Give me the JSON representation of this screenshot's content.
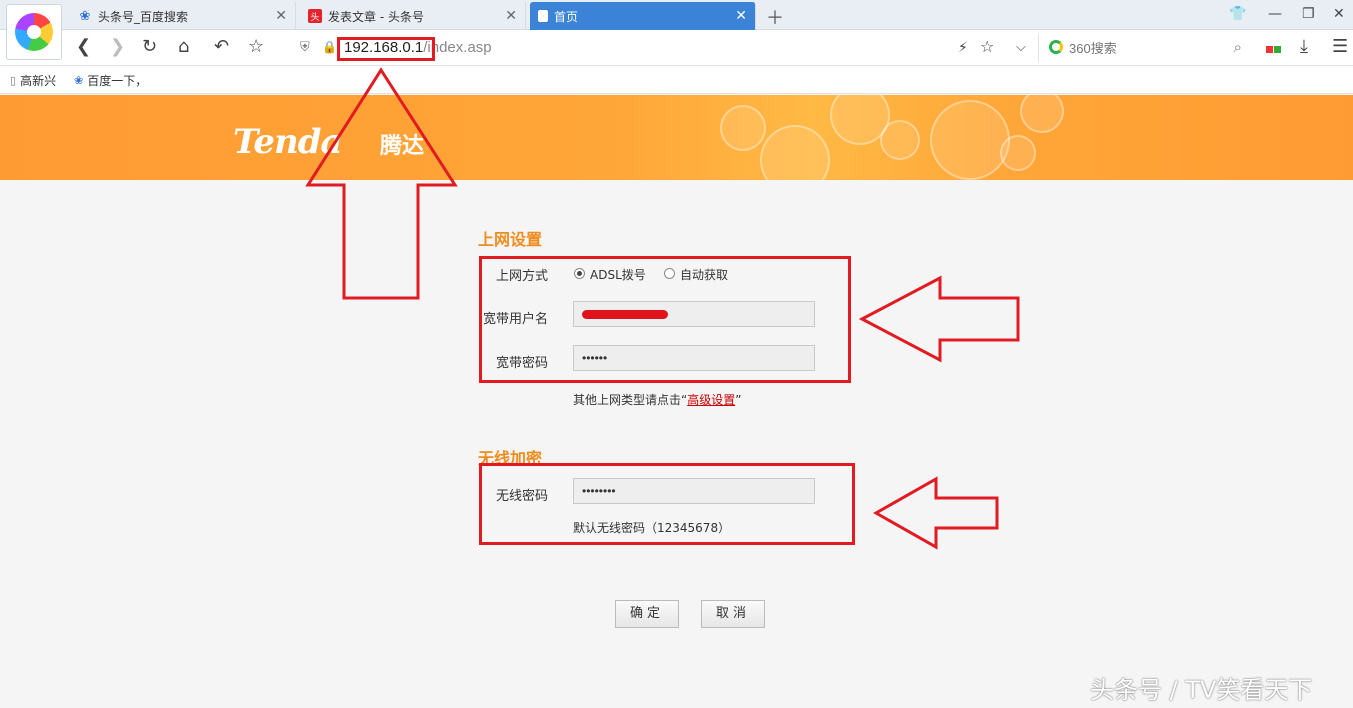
{
  "tabs": [
    {
      "title": "头条号_百度搜索",
      "active": false
    },
    {
      "title": "发表文章 - 头条号",
      "active": false
    },
    {
      "title": "首页",
      "active": true
    }
  ],
  "address": {
    "host": "192.168.0.1",
    "path": "/index.asp"
  },
  "search": {
    "placeholder": "360搜索"
  },
  "bookmarks": [
    "高新兴",
    "百度一下，"
  ],
  "brand": {
    "name": "Tenda",
    "cn": "腾达"
  },
  "internet": {
    "title": "上网设置",
    "mode_label": "上网方式",
    "mode_options": [
      "ADSL拨号",
      "自动获取"
    ],
    "selected_mode": "ADSL拨号",
    "username_label": "宽带用户名",
    "password_label": "宽带密码",
    "password_value": "••••••",
    "hint_prefix": "其他上网类型请点击“",
    "hint_link": "高级设置",
    "hint_suffix": "”"
  },
  "wireless": {
    "title": "无线加密",
    "password_label": "无线密码",
    "password_value": "••••••••",
    "default_hint": "默认无线密码（12345678）"
  },
  "buttons": {
    "ok": "确定",
    "cancel": "取消"
  },
  "watermark": "头条号 / TV笑看天下"
}
